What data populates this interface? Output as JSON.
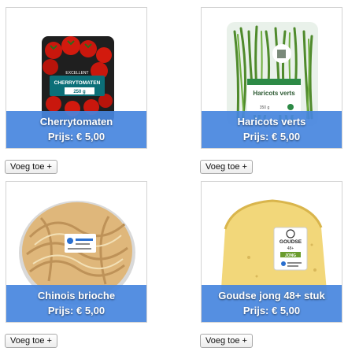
{
  "products": [
    {
      "name": "Cherrytomaten",
      "price": "Prijs: € 5,00",
      "add_label": "Voeg toe +",
      "pack_brand": "EXCELLENT",
      "pack_text": "CHERRYTOMATEN",
      "pack_weight": "250 g"
    },
    {
      "name": "Haricots verts",
      "price": "Prijs: € 5,00",
      "add_label": "Voeg toe +",
      "pack_text": "Haricots verts",
      "pack_weight": "350 g"
    },
    {
      "name": "Chinois brioche",
      "price": "Prijs: € 5,00",
      "add_label": "Voeg toe +"
    },
    {
      "name": "Goudse jong 48+ stuk",
      "price": "Prijs: € 5,00",
      "add_label": "Voeg toe +",
      "pack_text": "GOUDSE",
      "pack_sub": "48+",
      "pack_tag": "JONG"
    }
  ],
  "colors": {
    "accent": "#4686de",
    "card_border": "#d4d4d4"
  }
}
